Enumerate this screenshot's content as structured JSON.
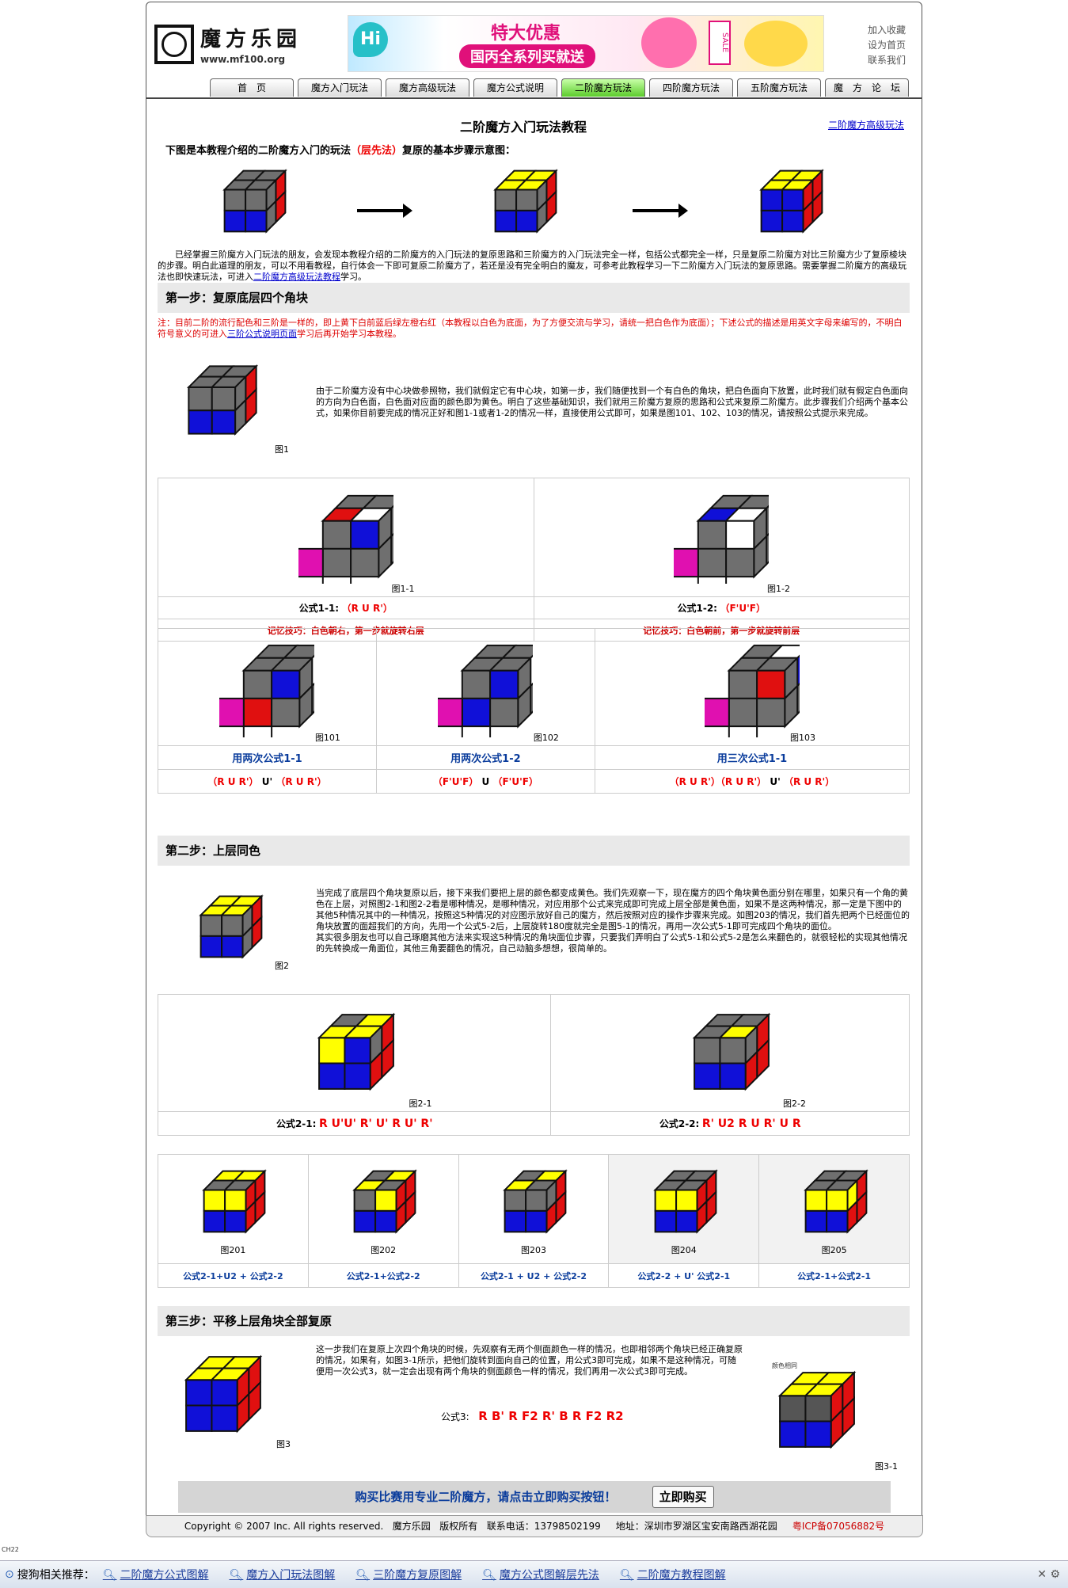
{
  "site": {
    "logo_name": "魔方乐园",
    "logo_url": "www.mf100.org",
    "top_links": [
      "加入收藏",
      "设为首页",
      "联系我们"
    ],
    "banner": {
      "hi": "Hi",
      "headline": "特大优惠",
      "tagline": "国丙全系列买就送",
      "sale": "SALE"
    }
  },
  "nav": {
    "tabs": [
      "首　页",
      "魔方入门玩法",
      "魔方高级玩法",
      "魔方公式说明",
      "二阶魔方玩法",
      "四阶魔方玩法",
      "五阶魔方玩法",
      "魔　方　论　坛"
    ],
    "active_index": 4
  },
  "page": {
    "title": "二阶魔方入门玩法教程",
    "adv_link": "二阶魔方高级玩法",
    "intro_prefix": "下图是本教程介绍的二阶魔方入门的玩法",
    "intro_red": "（层先法）",
    "intro_suffix": "复原的基本步骤示意图：",
    "intro_para_1": "　　已经掌握三阶魔方入门玩法的朋友，会发现本教程介绍的二阶魔方的入门玩法的复原思路和三阶魔方的入门玩法完全一样，包括公式都完全一样，只是复原二阶魔方对比三阶魔方少了复原棱块的步骤。明白此道理的朋友，可以不用看教程，自行体会一下即可复原二阶魔方了，若还是没有完全明白的魔友，可参考此教程学习一下二阶魔方入门玩法的复原思路。需要掌握二阶魔方的高级玩法也即快速玩法，可进入",
    "intro_para_link": "二阶魔方高级玩法教程",
    "intro_para_2": "学习。"
  },
  "step1": {
    "heading": "第一步：复原底层四个角块",
    "note_1": "注：目前二阶的流行配色和三阶是一样的，即上黄下白前蓝后绿左橙右红（本教程以白色为底面，为了方便交流与学习，请统一把白色作为底面）；下述公式的描述是用英文字母来编写的，不明白符号意义的可进入",
    "note_link": "三阶公式说明页面",
    "note_2": "学习后再开始学习本教程。",
    "explain": "由于二阶魔方没有中心块做参照物，我们就假定它有中心块，如第一步，我们随便找到一个有白色的角块，把白色面向下放置，此时我们就有假定白色面向的方向为白色面，白色面对应面的颜色即为黄色。明白了这些基础知识，我们就用三阶魔方复原的思路和公式来复原二阶魔方。此步骤我们介绍两个基本公式，如果你目前要完成的情况正好和图1-1或者1-2的情况一样，直接使用公式即可，如果是图101、102、103的情况，请按照公式提示来完成。",
    "fig1": "图1",
    "cases": [
      {
        "fig": "图1-1",
        "formula_label": "公式1-1:",
        "formula": "（R U R'）",
        "memo": "记忆技巧：白色朝右，第一步就旋转右层"
      },
      {
        "fig": "图1-2",
        "formula_label": "公式1-2:",
        "formula": "（F'U'F）",
        "memo": "记忆技巧：白色朝前，第一步就旋转前层"
      }
    ],
    "combos": [
      {
        "fig": "图101",
        "title": "用两次公式1-1",
        "formula_a": "（R U R'）",
        "mid": "U'",
        "formula_b": "（R U R'）"
      },
      {
        "fig": "图102",
        "title": "用两次公式1-2",
        "formula_a": "（F'U'F）",
        "mid": "U",
        "formula_b": "（F'U'F）"
      },
      {
        "fig": "图103",
        "title": "用三次公式1-1",
        "formula_a": "（R U R'）（R U R'）",
        "mid": "U'",
        "formula_b": "（R U R'）"
      }
    ]
  },
  "step2": {
    "heading": "第二步：上层同色",
    "explain_1": "当完成了底层四个角块复原以后，接下来我们要把上层的颜色都变成黄色。我们先观察一下，现在魔方的四个角块黄色面分别在哪里，如果只有一个角的黄色在上层，对照图2-1和图2-2看是哪种情况，是哪种情况，对应用那个公式来完成即可完成上层全部是黄色面，如果不是这两种情况，那一定是下图中的其他5种情况其中的一种情况，按照这5种情况的对应图示放好自己的魔方，然后按照对应的操作步骤来完成。如图203的情况，我们首先把两个已经面位的角块放置的面超我们的方向，先用一个公式5-2后，上层旋转180度就完全是图5-1的情况，再用一次公式5-1即可完成四个角块的面位。",
    "explain_2": "其实很多朋友也可以自己琢磨其他方法来实现这5种情况的角块面位步骤，只要我们弄明白了公式5-1和公式5-2是怎么来翻色的，就很轻松的实现其他情况的先转换成一角面位，其他三角要翻色的情况，自己动脑多想想，很简单的。",
    "fig2": "图2",
    "cases": [
      {
        "fig": "图2-1",
        "formula_label": "公式2-1:",
        "formula": "R U'U' R' U' R U' R'"
      },
      {
        "fig": "图2-2",
        "formula_label": "公式2-2:",
        "formula": "R' U2 R U R' U R"
      }
    ],
    "others": [
      {
        "fig": "图201",
        "text": "公式2-1+U2 + 公式2-2"
      },
      {
        "fig": "图202",
        "text": "公式2-1+公式2-2"
      },
      {
        "fig": "图203",
        "text": "公式2-1 + U2 + 公式2-2"
      },
      {
        "fig": "图204",
        "text": "公式2-2 + U' 公式2-1"
      },
      {
        "fig": "图205",
        "text": "公式2-1+公式2-1"
      }
    ]
  },
  "step3": {
    "heading": "第三步：平移上层角块全部复原",
    "explain": "这一步我们在复原上次四个角块的时候，先观察有无两个侧面颜色一样的情况，也即相邻两个角块已经正确复原的情况，如果有，如图3-1所示，把他们旋转到面向自己的位置，用公式3即可完成，如果不是这种情况，可随便用一次公式3，就一定会出现有两个角块的侧面颜色一样的情况，我们再用一次公式3即可完成。",
    "formula_label": "公式3:",
    "formula": "R B' R F2 R' B R F2 R2",
    "fig3": "图3",
    "fig31": "图3-1",
    "fig31_label": "颜色相同"
  },
  "buy": {
    "text": "购买比赛用专业二阶魔方，请点击立即购买按钮！",
    "button": "立即购买"
  },
  "footer": {
    "copyright": "Copyright © 2007 Inc. All rights reserved.",
    "name": "魔方乐园",
    "rights": "版权所有",
    "phone": "联系电话：13798502199",
    "address": "地址：深圳市罗湖区宝安南路西湖花园",
    "icp": "粤ICP备07056882号"
  },
  "bottom_bar": {
    "label": "搜狗相关推荐：",
    "items": [
      "二阶魔方公式图解",
      "魔方入门玩法图解",
      "三阶魔方复原图解",
      "魔方公式图解层先法",
      "二阶魔方教程图解"
    ],
    "lang": "CH22"
  },
  "colors": {
    "blue": "#1010d8",
    "red": "#e01010",
    "yellow": "#ffff00",
    "gray": "#6f6f6f",
    "magenta": "#e010b0",
    "white": "#ffffff"
  }
}
